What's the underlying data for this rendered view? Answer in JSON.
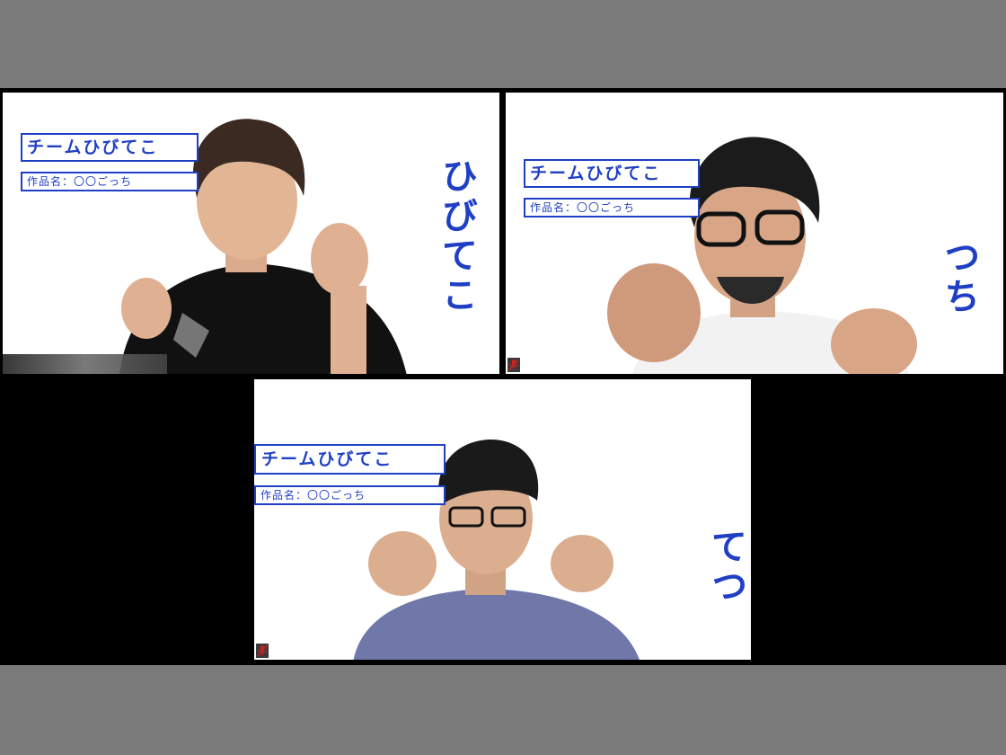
{
  "participants": [
    {
      "team_label": "チームひびてこ",
      "work_label": "作品名：〇〇ごっち",
      "vertical_name": "ひびてこ",
      "shirt_color": "#111111"
    },
    {
      "team_label": "チームひびてこ",
      "work_label": "作品名：〇〇ごっち",
      "vertical_name": "つち",
      "shirt_color": "#f2f2f2"
    },
    {
      "team_label": "チームひびてこ",
      "work_label": "作品名：〇〇ごっち",
      "vertical_name": "てつ",
      "shirt_color": "#6f78a8"
    }
  ],
  "colors": {
    "accent_blue": "#1f3fc4",
    "outer_frame": "#7a7a7a",
    "gallery_background": "#000000",
    "mic_muted": "#d02020"
  },
  "icons": [
    "mic-muted-icon"
  ]
}
